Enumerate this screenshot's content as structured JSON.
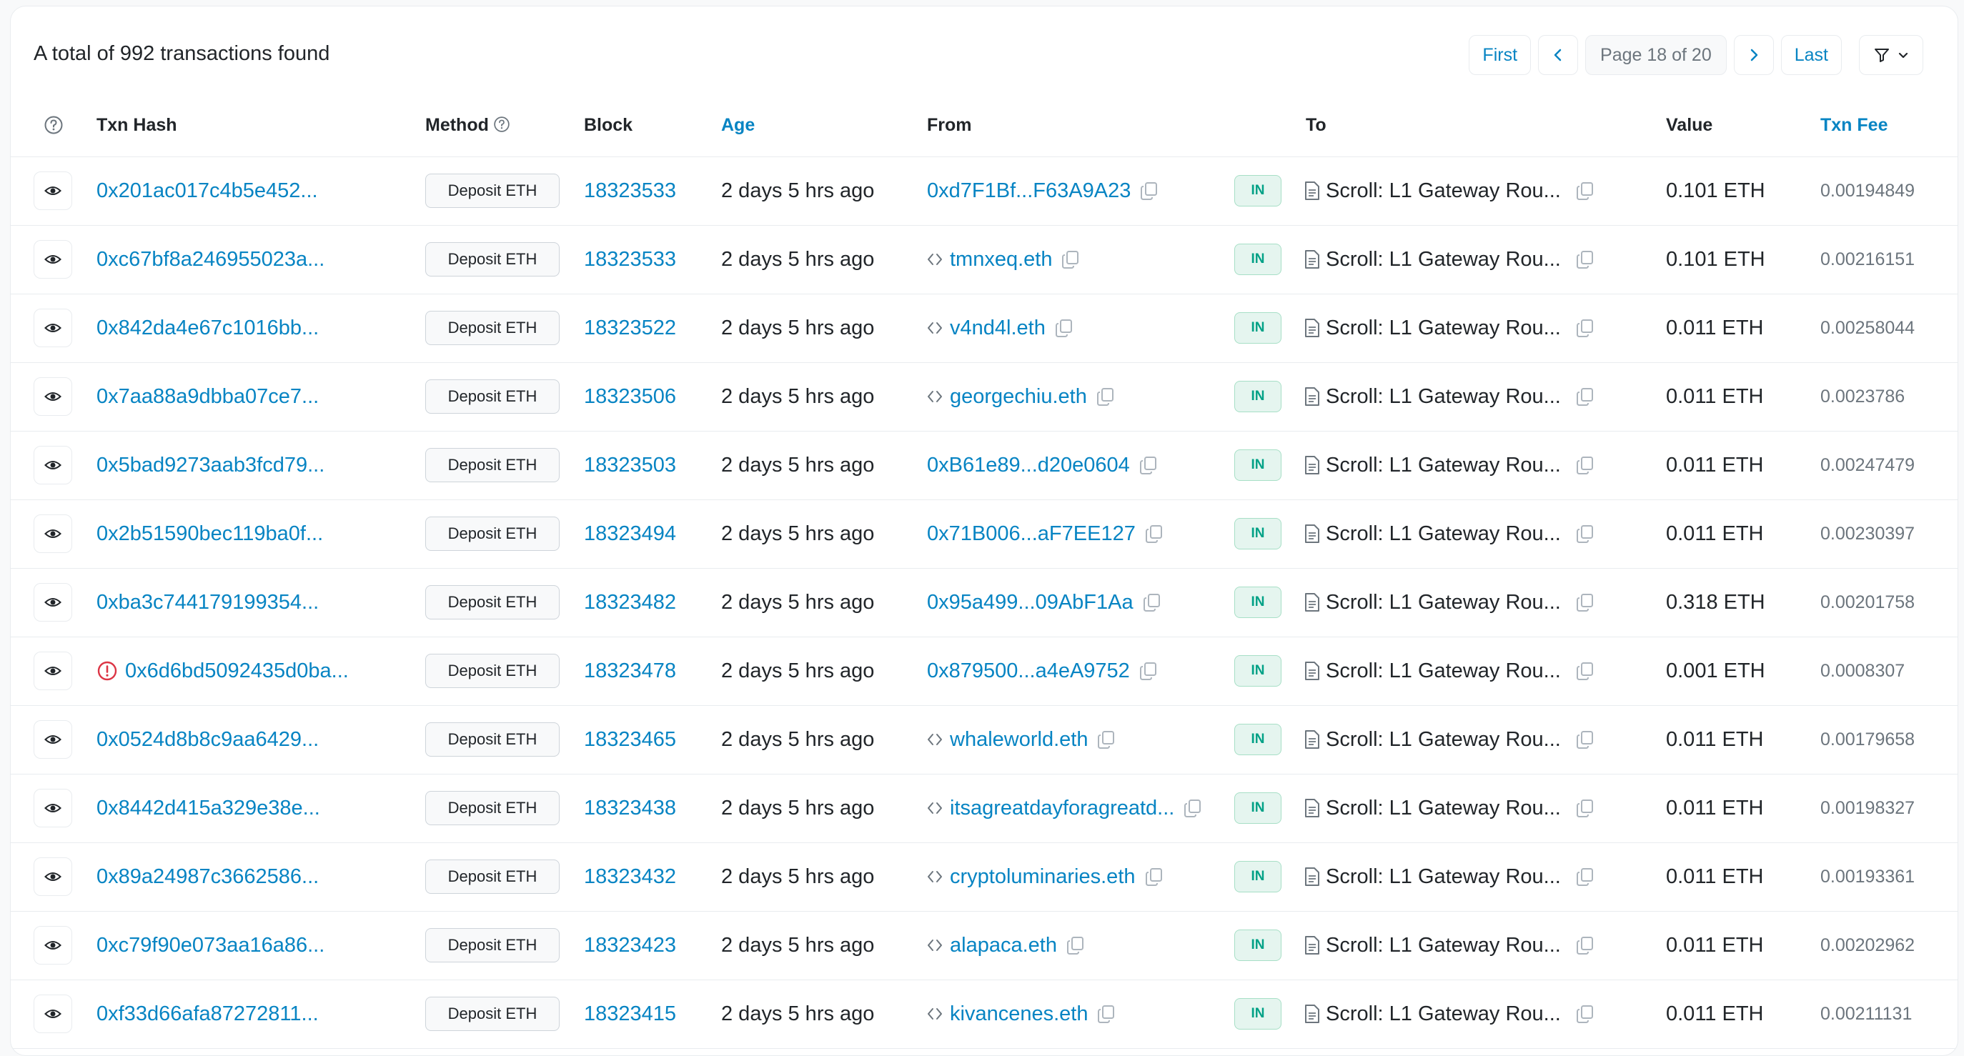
{
  "summary": "A total of 992 transactions found",
  "pagination": {
    "first": "First",
    "page": "Page 18 of 20",
    "last": "Last"
  },
  "columns": {
    "txn_hash": "Txn Hash",
    "method": "Method",
    "block": "Block",
    "age": "Age",
    "from": "From",
    "to": "To",
    "value": "Value",
    "txn_fee": "Txn Fee"
  },
  "colors": {
    "link": "#0784c3",
    "in_badge": "#00a186",
    "error": "#dc3545"
  },
  "rows": [
    {
      "hash": "0x201ac017c4b5e452...",
      "error": false,
      "method": "Deposit ETH",
      "block": "18323533",
      "age": "2 days 5 hrs ago",
      "from": "0xd7F1Bf...F63A9A23",
      "from_contract": false,
      "direction": "IN",
      "to": "Scroll: L1 Gateway Rou...",
      "value": "0.101 ETH",
      "fee": "0.00194849"
    },
    {
      "hash": "0xc67bf8a246955023a...",
      "error": false,
      "method": "Deposit ETH",
      "block": "18323533",
      "age": "2 days 5 hrs ago",
      "from": "tmnxeq.eth",
      "from_contract": true,
      "direction": "IN",
      "to": "Scroll: L1 Gateway Rou...",
      "value": "0.101 ETH",
      "fee": "0.00216151"
    },
    {
      "hash": "0x842da4e67c1016bb...",
      "error": false,
      "method": "Deposit ETH",
      "block": "18323522",
      "age": "2 days 5 hrs ago",
      "from": "v4nd4l.eth",
      "from_contract": true,
      "direction": "IN",
      "to": "Scroll: L1 Gateway Rou...",
      "value": "0.011 ETH",
      "fee": "0.00258044"
    },
    {
      "hash": "0x7aa88a9dbba07ce7...",
      "error": false,
      "method": "Deposit ETH",
      "block": "18323506",
      "age": "2 days 5 hrs ago",
      "from": "georgechiu.eth",
      "from_contract": true,
      "direction": "IN",
      "to": "Scroll: L1 Gateway Rou...",
      "value": "0.011 ETH",
      "fee": "0.0023786"
    },
    {
      "hash": "0x5bad9273aab3fcd79...",
      "error": false,
      "method": "Deposit ETH",
      "block": "18323503",
      "age": "2 days 5 hrs ago",
      "from": "0xB61e89...d20e0604",
      "from_contract": false,
      "direction": "IN",
      "to": "Scroll: L1 Gateway Rou...",
      "value": "0.011 ETH",
      "fee": "0.00247479"
    },
    {
      "hash": "0x2b51590bec119ba0f...",
      "error": false,
      "method": "Deposit ETH",
      "block": "18323494",
      "age": "2 days 5 hrs ago",
      "from": "0x71B006...aF7EE127",
      "from_contract": false,
      "direction": "IN",
      "to": "Scroll: L1 Gateway Rou...",
      "value": "0.011 ETH",
      "fee": "0.00230397"
    },
    {
      "hash": "0xba3c744179199354...",
      "error": false,
      "method": "Deposit ETH",
      "block": "18323482",
      "age": "2 days 5 hrs ago",
      "from": "0x95a499...09AbF1Aa",
      "from_contract": false,
      "direction": "IN",
      "to": "Scroll: L1 Gateway Rou...",
      "value": "0.318 ETH",
      "fee": "0.00201758"
    },
    {
      "hash": "0x6d6bd5092435d0ba...",
      "error": true,
      "method": "Deposit ETH",
      "block": "18323478",
      "age": "2 days 5 hrs ago",
      "from": "0x879500...a4eA9752",
      "from_contract": false,
      "direction": "IN",
      "to": "Scroll: L1 Gateway Rou...",
      "value": "0.001 ETH",
      "fee": "0.0008307"
    },
    {
      "hash": "0x0524d8b8c9aa6429...",
      "error": false,
      "method": "Deposit ETH",
      "block": "18323465",
      "age": "2 days 5 hrs ago",
      "from": "whaleworld.eth",
      "from_contract": true,
      "direction": "IN",
      "to": "Scroll: L1 Gateway Rou...",
      "value": "0.011 ETH",
      "fee": "0.00179658"
    },
    {
      "hash": "0x8442d415a329e38e...",
      "error": false,
      "method": "Deposit ETH",
      "block": "18323438",
      "age": "2 days 5 hrs ago",
      "from": "itsagreatdayforagreatd...",
      "from_contract": true,
      "direction": "IN",
      "to": "Scroll: L1 Gateway Rou...",
      "value": "0.011 ETH",
      "fee": "0.00198327"
    },
    {
      "hash": "0x89a24987c3662586...",
      "error": false,
      "method": "Deposit ETH",
      "block": "18323432",
      "age": "2 days 5 hrs ago",
      "from": "cryptoluminaries.eth",
      "from_contract": true,
      "direction": "IN",
      "to": "Scroll: L1 Gateway Rou...",
      "value": "0.011 ETH",
      "fee": "0.00193361"
    },
    {
      "hash": "0xc79f90e073aa16a86...",
      "error": false,
      "method": "Deposit ETH",
      "block": "18323423",
      "age": "2 days 5 hrs ago",
      "from": "alapaca.eth",
      "from_contract": true,
      "direction": "IN",
      "to": "Scroll: L1 Gateway Rou...",
      "value": "0.011 ETH",
      "fee": "0.00202962"
    },
    {
      "hash": "0xf33d66afa87272811...",
      "error": false,
      "method": "Deposit ETH",
      "block": "18323415",
      "age": "2 days 5 hrs ago",
      "from": "kivancenes.eth",
      "from_contract": true,
      "direction": "IN",
      "to": "Scroll: L1 Gateway Rou...",
      "value": "0.011 ETH",
      "fee": "0.00211131"
    }
  ]
}
